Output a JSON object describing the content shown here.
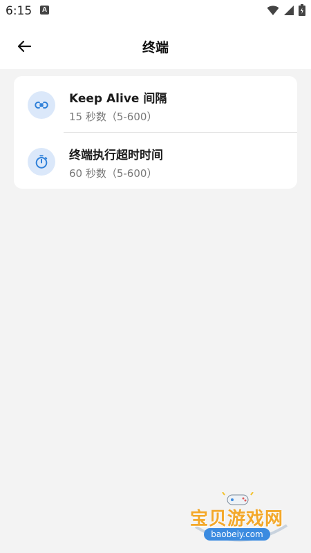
{
  "status_bar": {
    "time": "6:15",
    "notification_icon": "a-icon",
    "icons": [
      "wifi-icon",
      "signal-icon",
      "battery-icon"
    ]
  },
  "app_bar": {
    "back_icon": "arrow-left-icon",
    "title": "终端"
  },
  "settings": [
    {
      "icon": "link-icon",
      "title": "Keep Alive 间隔",
      "subtitle": "15 秒数（5-600）"
    },
    {
      "icon": "timer-icon",
      "title": "终端执行超时时间",
      "subtitle": "60 秒数（5-600）"
    }
  ],
  "watermark": {
    "name": "宝贝游戏网",
    "domain": "baobeiy.com"
  },
  "colors": {
    "accent": "#2f80d9",
    "icon_bg": "#dbe8fa",
    "page_bg": "#f3f3f3"
  }
}
